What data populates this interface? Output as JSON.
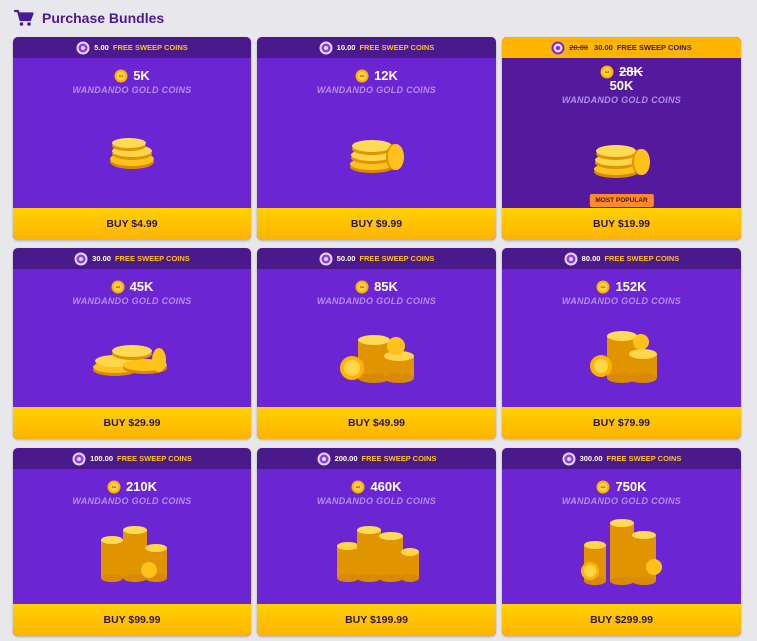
{
  "page": {
    "title": "Purchase Bundles",
    "icon": "cart-icon"
  },
  "colors": {
    "title": "#4b1a96",
    "card": "#6c25d2",
    "card_featured": "#54199c",
    "topbar": "#4a1a8c",
    "topbar_featured": "#ffb400",
    "buy_button": "#ffc400",
    "coin_label": "#b38cf7",
    "sweep_label": "#ffc21a",
    "badge": "#ff8a2a"
  },
  "bundles": [
    {
      "sweep_amount": "5.00",
      "sweep_label": "FREE SWEEP COINS",
      "gold_amount": "5K",
      "gold_label": "WANDANDO GOLD COINS",
      "buy_label": "BUY $4.99"
    },
    {
      "sweep_amount": "10.00",
      "sweep_label": "FREE SWEEP COINS",
      "gold_amount": "12K",
      "gold_label": "WANDANDO GOLD COINS",
      "buy_label": "BUY $9.99"
    },
    {
      "sweep_old_amount": "20.00",
      "sweep_amount": "30.00",
      "sweep_label": "FREE SWEEP COINS",
      "gold_old_amount": "28K",
      "gold_amount": "50K",
      "gold_label": "WANDANDO GOLD COINS",
      "badge": "MOST POPULAR",
      "buy_label": "BUY $19.99",
      "featured": true
    },
    {
      "sweep_amount": "30.00",
      "sweep_label": "FREE SWEEP COINS",
      "gold_amount": "45K",
      "gold_label": "WANDANDO GOLD COINS",
      "buy_label": "BUY $29.99"
    },
    {
      "sweep_amount": "50.00",
      "sweep_label": "FREE SWEEP COINS",
      "gold_amount": "85K",
      "gold_label": "WANDANDO GOLD COINS",
      "buy_label": "BUY $49.99"
    },
    {
      "sweep_amount": "80.00",
      "sweep_label": "FREE SWEEP COINS",
      "gold_amount": "152K",
      "gold_label": "WANDANDO GOLD COINS",
      "buy_label": "BUY $79.99"
    },
    {
      "sweep_amount": "100.00",
      "sweep_label": "FREE SWEEP COINS",
      "gold_amount": "210K",
      "gold_label": "WANDANDO GOLD COINS",
      "buy_label": "BUY $99.99"
    },
    {
      "sweep_amount": "200.00",
      "sweep_label": "FREE SWEEP COINS",
      "gold_amount": "460K",
      "gold_label": "WANDANDO GOLD COINS",
      "buy_label": "BUY $199.99"
    },
    {
      "sweep_amount": "300.00",
      "sweep_label": "FREE SWEEP COINS",
      "gold_amount": "750K",
      "gold_label": "WANDANDO GOLD COINS",
      "buy_label": "BUY $299.99"
    }
  ]
}
